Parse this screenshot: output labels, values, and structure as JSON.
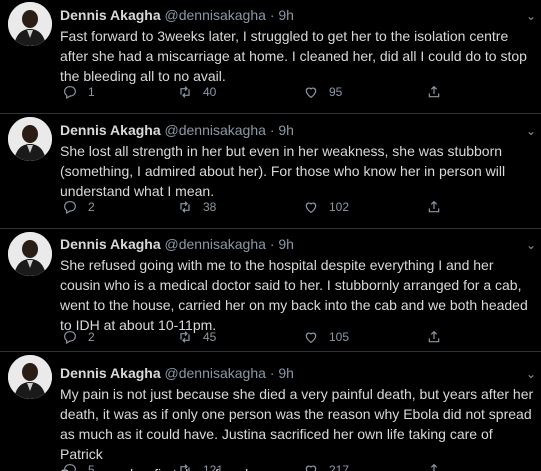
{
  "colors": {
    "background": "#000000",
    "text": "#d9d9d9",
    "muted": "#8b98a5",
    "divider": "#2f3336"
  },
  "tweets": [
    {
      "name": "Dennis Akagha",
      "handle": "@dennisakagha",
      "dot": "·",
      "time": "9h",
      "text": "Fast forward to 3weeks later, I struggled to get her to the isolation centre\nafter she had a miscarriage at home. I cleaned her, did all I could do to stop\nthe bleeding all to no avail.",
      "replies": "1",
      "retweets": "40",
      "likes": "95"
    },
    {
      "name": "Dennis Akagha",
      "handle": "@dennisakagha",
      "dot": "·",
      "time": "9h",
      "text": "She lost all strength in her but even in her weakness, she was stubborn\n(something, I admired about her). For those who know her in person will\nunderstand what I mean.",
      "replies": "2",
      "retweets": "38",
      "likes": "102"
    },
    {
      "name": "Dennis Akagha",
      "handle": "@dennisakagha",
      "dot": "·",
      "time": "9h",
      "text": "She refused going with me to the hospital despite everything I and her\ncousin who is a medical doctor said to her. I stubbornly arranged for a cab,\nwent to the house, carried her on my back into the cab and we both headed\nto IDH at about 10-11pm.",
      "replies": "2",
      "retweets": "45",
      "likes": "105"
    },
    {
      "name": "Dennis Akagha",
      "handle": "@dennisakagha",
      "dot": "·",
      "time": "9h",
      "text": "My pain is not just because she died a very painful death, but years after her\ndeath, it was as if only one person was the reason why Ebola did not spread\nas much as it could have. Justina sacrificed her own life taking care of Patrick\nSawyer on her first day of work.",
      "replies": "5",
      "retweets": "121",
      "likes": "217"
    }
  ],
  "icons": {
    "reply": "reply-icon",
    "retweet": "retweet-icon",
    "like": "like-icon",
    "share": "share-icon",
    "more": "chevron-down-icon"
  }
}
